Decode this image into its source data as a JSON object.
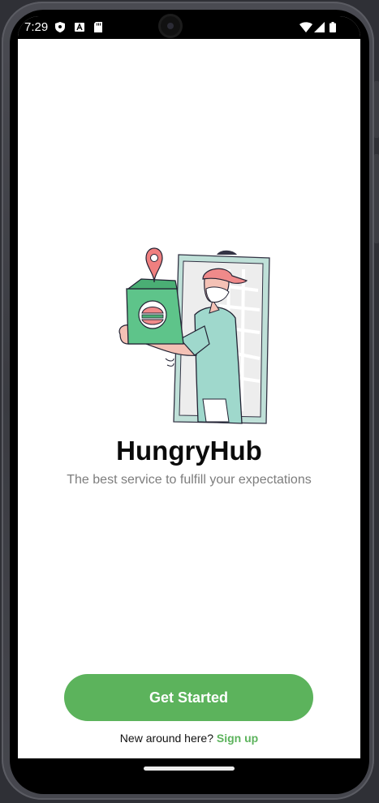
{
  "status_bar": {
    "time": "7:29"
  },
  "app": {
    "title": "HungryHub",
    "subtitle": "The best service to fulfill your expectations"
  },
  "actions": {
    "get_started_label": "Get Started",
    "signup_prompt": "New around here?",
    "signup_link": "Sign up"
  },
  "colors": {
    "accent": "#5cb35c",
    "title": "#0b0b0b",
    "subtitle": "#7d7d7d",
    "background": "#ffffff"
  },
  "icons": {
    "status_left": [
      "shield-icon",
      "a-icon",
      "sd-card-icon"
    ],
    "status_right": [
      "wifi-icon",
      "cell-signal-icon",
      "battery-icon"
    ]
  }
}
